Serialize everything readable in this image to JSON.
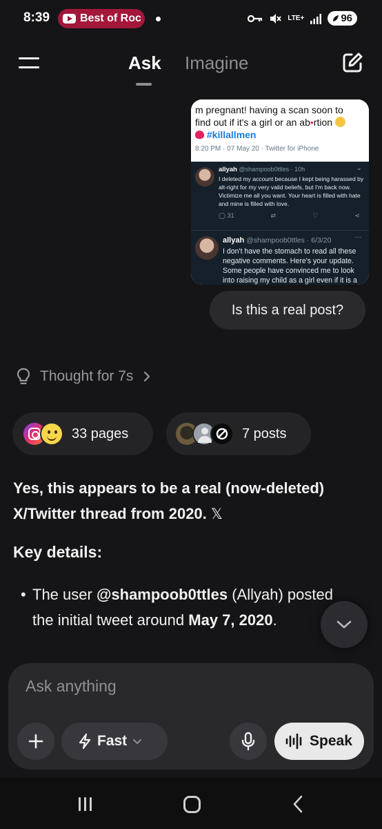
{
  "status_bar": {
    "time": "8:39",
    "notification_label": "Best of Roc",
    "network_label": "LTE+",
    "battery": "96"
  },
  "header": {
    "tabs": [
      {
        "label": "Ask",
        "active": true
      },
      {
        "label": "Imagine",
        "active": false
      }
    ]
  },
  "attachment": {
    "tweet_text_1": "m pregnant! having a scan soon to",
    "tweet_text_2": "find out if it's a girl or an ab",
    "tweet_text_2b": "rtion",
    "tweet_hashtag": "#killallmen",
    "tweet_meta": "8:20 PM · 07 May 20 · Twitter for iPhone",
    "reply1_name": "allyah",
    "reply1_handle": "@shampoob0ttles · 10h",
    "reply1_body": "I deleted my account because I kept being harassed by alt-right for my very valid beliefs, but I'm back now. Victimize me all you want. Your heart is filled with hate and mine is filled with love.",
    "reply1_replies": "31",
    "reply2_name": "allyah",
    "reply2_handle": "@shampoob0ttles · 6/3/20",
    "reply2_body": "I don't have the stomach to read all these negative comments. Here's your update. Some people have convinced me to look into raising my child as a girl even if it is a boy, and trying to get treatment as early"
  },
  "user_message": "Is this a real post?",
  "thought": {
    "label": "Thought for 7s"
  },
  "sources": {
    "pages_label": "33 pages",
    "posts_label": "7 posts"
  },
  "answer": {
    "lead": "Yes, this appears to be a real (now-deleted) X/Twitter thread from 2020.",
    "x_glyph": "𝕏",
    "key_details_heading": "Key details:",
    "bullet_1_prefix": "The user ",
    "bullet_1_handle": "@shampoob0ttles",
    "bullet_1_mid": " (Allyah) posted the initial tweet around ",
    "bullet_1_date": "May 7, 2020",
    "bullet_1_suffix": "."
  },
  "composer": {
    "placeholder": "Ask anything",
    "model_label": "Fast",
    "speak_label": "Speak"
  },
  "colors": {
    "background": "#151517",
    "surface": "#29292c",
    "notification_pill": "#a3173a",
    "speak_button": "#e9e9ea"
  },
  "icons": [
    "youtube-icon",
    "key-icon",
    "mute-icon",
    "signal-icon",
    "battery-icon",
    "menu-icon",
    "compose-icon",
    "lightbulb-icon",
    "chevron-right-icon",
    "instagram-icon",
    "smiley-icon",
    "avatar-icon",
    "x-icon",
    "chevron-down-icon",
    "plus-icon",
    "lightning-icon",
    "mic-icon",
    "waveform-icon",
    "recents-icon",
    "home-icon",
    "back-icon"
  ]
}
